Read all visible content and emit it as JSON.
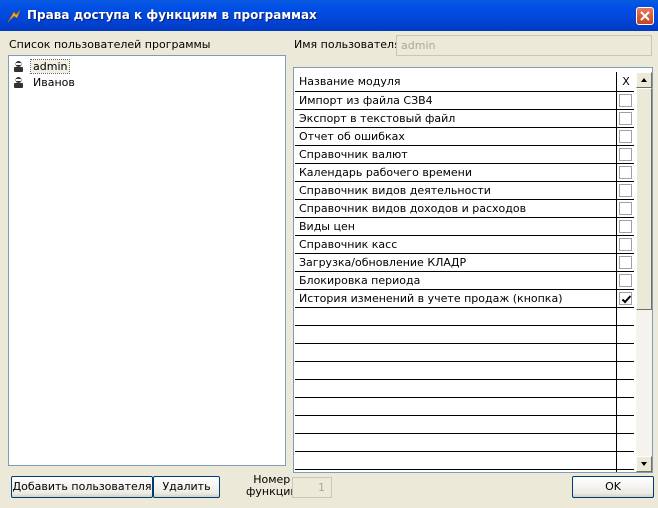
{
  "window": {
    "title": "Права доступа к функциям в программах"
  },
  "left_panel": {
    "label": "Список пользователей программы",
    "users": [
      {
        "name": "admin",
        "selected": true
      },
      {
        "name": "Иванов",
        "selected": false
      }
    ]
  },
  "username": {
    "label": "Имя пользователя",
    "value": "admin"
  },
  "grid": {
    "col_name_header": "Название модуля",
    "col_check_header": "X",
    "rows": [
      {
        "name": "Импорт из файла СЗВ4",
        "checked": false
      },
      {
        "name": "Экспорт в текстовый файл",
        "checked": false
      },
      {
        "name": "Отчет об ошибках",
        "checked": false
      },
      {
        "name": "Справочник валют",
        "checked": false
      },
      {
        "name": "Календарь рабочего времени",
        "checked": false
      },
      {
        "name": "Справочник видов деятельности",
        "checked": false
      },
      {
        "name": "Справочник видов доходов и расходов",
        "checked": false
      },
      {
        "name": "Виды цен",
        "checked": false
      },
      {
        "name": "Справочник касс",
        "checked": false
      },
      {
        "name": "Загрузка/обновление КЛАДР",
        "checked": false
      },
      {
        "name": "Блокировка периода",
        "checked": false
      },
      {
        "name": "История изменений в учете продаж (кнопка)",
        "checked": true
      },
      {
        "name": "",
        "checked": null
      },
      {
        "name": "",
        "checked": null
      },
      {
        "name": "",
        "checked": null
      },
      {
        "name": "",
        "checked": null
      },
      {
        "name": "",
        "checked": null
      },
      {
        "name": "",
        "checked": null
      },
      {
        "name": "",
        "checked": null
      },
      {
        "name": "",
        "checked": null
      },
      {
        "name": "",
        "checked": null
      },
      {
        "name": "",
        "checked": null
      }
    ]
  },
  "buttons": {
    "add_user": "Добавить пользователя",
    "delete": "Удалить",
    "ok": "OK"
  },
  "function_number": {
    "label_line1": "Номер",
    "label_line2": "функции",
    "value": "1"
  }
}
